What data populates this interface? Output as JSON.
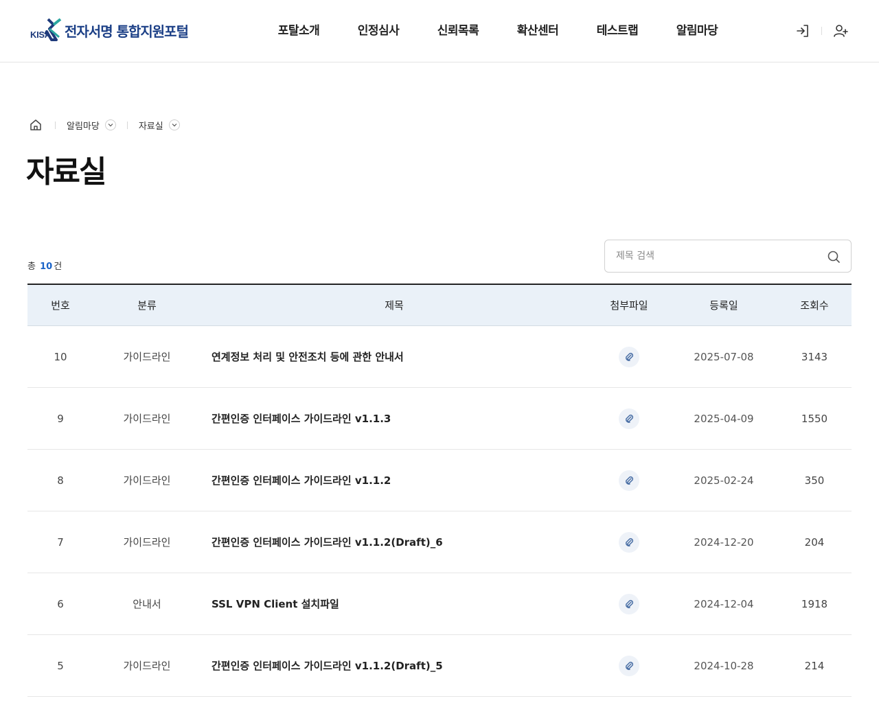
{
  "header": {
    "logo_kisa": "KISA",
    "logo_text": "전자서명 통합지원포털",
    "nav": [
      "포탈소개",
      "인정심사",
      "신뢰목록",
      "확산센터",
      "테스트랩",
      "알림마당"
    ],
    "icons": [
      "login-icon",
      "signup-icon"
    ]
  },
  "breadcrumb": {
    "items": [
      "알림마당",
      "자료실"
    ]
  },
  "page_title": "자료실",
  "total": {
    "prefix": "총",
    "count": "10",
    "suffix": "건"
  },
  "search": {
    "placeholder": "제목 검색"
  },
  "table": {
    "headers": [
      "번호",
      "분류",
      "제목",
      "첨부파일",
      "등록일",
      "조회수"
    ],
    "rows": [
      {
        "no": "10",
        "category": "가이드라인",
        "title": "연계정보 처리 및 안전조치 등에 관한 안내서",
        "date": "2025-07-08",
        "views": "3143"
      },
      {
        "no": "9",
        "category": "가이드라인",
        "title": "간편인증 인터페이스 가이드라인 v1.1.3",
        "date": "2025-04-09",
        "views": "1550"
      },
      {
        "no": "8",
        "category": "가이드라인",
        "title": "간편인증 인터페이스 가이드라인 v1.1.2",
        "date": "2025-02-24",
        "views": "350"
      },
      {
        "no": "7",
        "category": "가이드라인",
        "title": "간편인증 인터페이스 가이드라인 v1.1.2(Draft)_6",
        "date": "2024-12-20",
        "views": "204"
      },
      {
        "no": "6",
        "category": "안내서",
        "title": "SSL VPN Client 설치파일",
        "date": "2024-12-04",
        "views": "1918"
      },
      {
        "no": "5",
        "category": "가이드라인",
        "title": "간편인증 인터페이스 가이드라인 v1.1.2(Draft)_5",
        "date": "2024-10-28",
        "views": "214"
      }
    ]
  },
  "colors": {
    "brand": "#1b3f86",
    "accent": "#1a63c7",
    "table_header_bg": "#eaf1f8"
  }
}
